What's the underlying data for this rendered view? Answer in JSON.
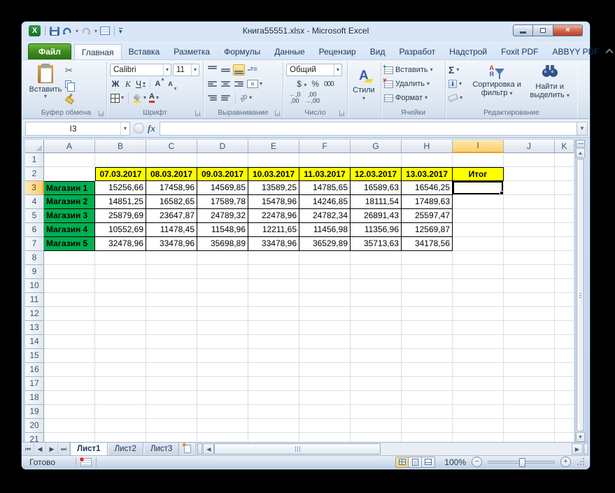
{
  "window": {
    "title": "Книга55551.xlsx  -  Microsoft Excel"
  },
  "quick_access": {
    "icons": [
      "excel-logo",
      "save",
      "undo",
      "redo",
      "table-preview",
      "customize-quick-access"
    ]
  },
  "tabs": {
    "file": "Файл",
    "items": [
      "Главная",
      "Вставка",
      "Разметка",
      "Формулы",
      "Данные",
      "Рецензир",
      "Вид",
      "Разработ",
      "Надстрой",
      "Foxit PDF",
      "ABBYY PDF"
    ],
    "active": "Главная"
  },
  "ribbon": {
    "clipboard": {
      "group": "Буфер обмена",
      "paste": "Вставить"
    },
    "font": {
      "group": "Шрифт",
      "family": "Calibri",
      "size": "11",
      "bold": "Ж",
      "italic": "К",
      "underline": "Ч",
      "grow": "А",
      "shrink": "А",
      "color_letter": "А"
    },
    "alignment": {
      "group": "Выравнивание",
      "merge_letter": "а"
    },
    "number": {
      "group": "Число",
      "format": "Общий",
      "currency": "$",
      "percent": "%",
      "thousand": "000",
      "inc_dec": ",0",
      "dec_dec": ",00"
    },
    "styles": {
      "label": "Стили",
      "big_letter": "А"
    },
    "cells": {
      "group": "Ячейки",
      "insert": "Вставить",
      "delete": "Удалить",
      "format": "Формат"
    },
    "editing": {
      "group": "Редактирование",
      "autosum": "Σ",
      "sort": "Сортировка и фильтр",
      "find": "Найти и выделить",
      "sort_a": "А",
      "sort_ya": "Я"
    }
  },
  "formula_bar": {
    "name_box": "I3",
    "fx": "fx",
    "value": ""
  },
  "grid": {
    "columns": [
      "A",
      "B",
      "C",
      "D",
      "E",
      "F",
      "G",
      "H",
      "I",
      "J",
      "K"
    ],
    "visible_rows": 21,
    "selected_cell": {
      "col": "I",
      "row": 3
    },
    "date_row": {
      "row": 2,
      "dates": [
        "07.03.2017",
        "08.03.2017",
        "09.03.2017",
        "10.03.2017",
        "11.03.2017",
        "12.03.2017",
        "13.03.2017"
      ],
      "total": "Итог"
    },
    "shops": [
      {
        "name": "Магазин 1",
        "values": [
          "15256,66",
          "17458,96",
          "14569,85",
          "13589,25",
          "14785,65",
          "16589,63",
          "16546,25"
        ]
      },
      {
        "name": "Магазин 2",
        "values": [
          "14851,25",
          "16582,65",
          "17589,78",
          "15478,96",
          "14246,85",
          "18111,54",
          "17489,63"
        ]
      },
      {
        "name": "Магазин 3",
        "values": [
          "25879,69",
          "23647,87",
          "24789,32",
          "22478,96",
          "24782,34",
          "26891,43",
          "25597,47"
        ]
      },
      {
        "name": "Магазин 4",
        "values": [
          "10552,69",
          "11478,45",
          "11548,96",
          "12211,65",
          "11456,98",
          "11356,96",
          "12569,87"
        ]
      },
      {
        "name": "Магазин 5",
        "values": [
          "32478,96",
          "33478,96",
          "35698,89",
          "33478,96",
          "36529,89",
          "35713,63",
          "34178,56"
        ]
      }
    ]
  },
  "sheets": {
    "items": [
      "Лист1",
      "Лист2",
      "Лист3"
    ],
    "active": "Лист1"
  },
  "status": {
    "mode": "Готово",
    "zoom": "100%"
  },
  "colors": {
    "date_bg": "#ffff00",
    "shop_bg": "#00b050",
    "selection_header": "#fbce6c",
    "file_tab_green": "#3d8b1d"
  }
}
